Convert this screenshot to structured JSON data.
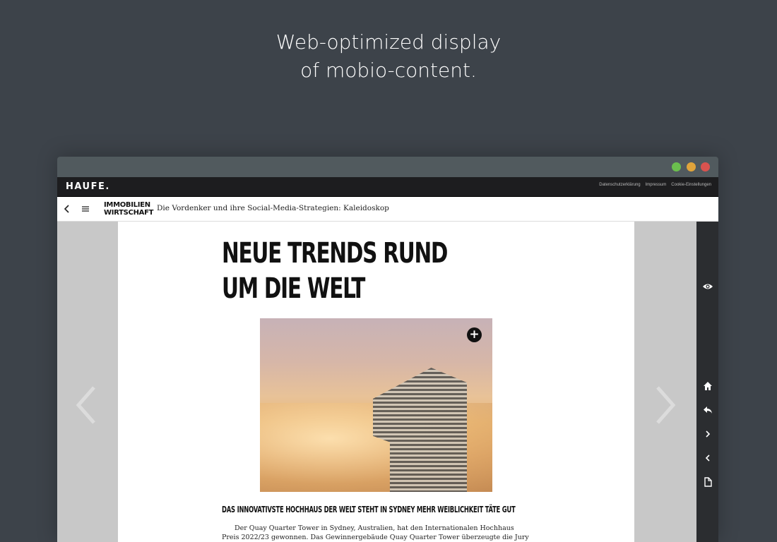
{
  "promo": {
    "line1": "Web-optimized display",
    "line2": "of mobio-content."
  },
  "window": {
    "traffic_lights": [
      "green",
      "yellow",
      "red"
    ]
  },
  "haufe_bar": {
    "logo": "HAUFE.",
    "links": [
      "Datenschutzerklärung",
      "Impressum",
      "Cookie-Einstellungen"
    ]
  },
  "navbar": {
    "brand_line1": "IMMOBILIEN",
    "brand_line2": "WIRTSCHAFT",
    "title": "Die Vordenker und ihre Social-Media-Strategien: Kaleidoskop"
  },
  "article": {
    "title_line1": "NEUE TRENDS RUND",
    "title_line2": "UM DIE WELT",
    "image_icon": "zoom-plus-icon",
    "subhead": "DAS INNOVATIVSTE HOCHHAUS DER WELT STEHT IN SYDNEY MEHR WEIBLICHKEIT TÄTE GUT",
    "body": "Der Quay Quarter Tower in Sydney, Australien, hat den Internationalen Hochhaus Preis 2022/23 gewonnen. Das Gewinnergebäude Quay Quarter Tower überzeugte die Jury als innovative Lösung für"
  },
  "sidebar": {
    "icons": [
      "eye-icon",
      "home-icon",
      "reply-icon",
      "chevron-right-icon",
      "chevron-left-icon",
      "document-icon"
    ]
  },
  "colors": {
    "background": "#3d434a",
    "titlebar": "#515a5e",
    "green": "#6bbf4e",
    "yellow": "#e0a43b",
    "red": "#d9534f"
  }
}
